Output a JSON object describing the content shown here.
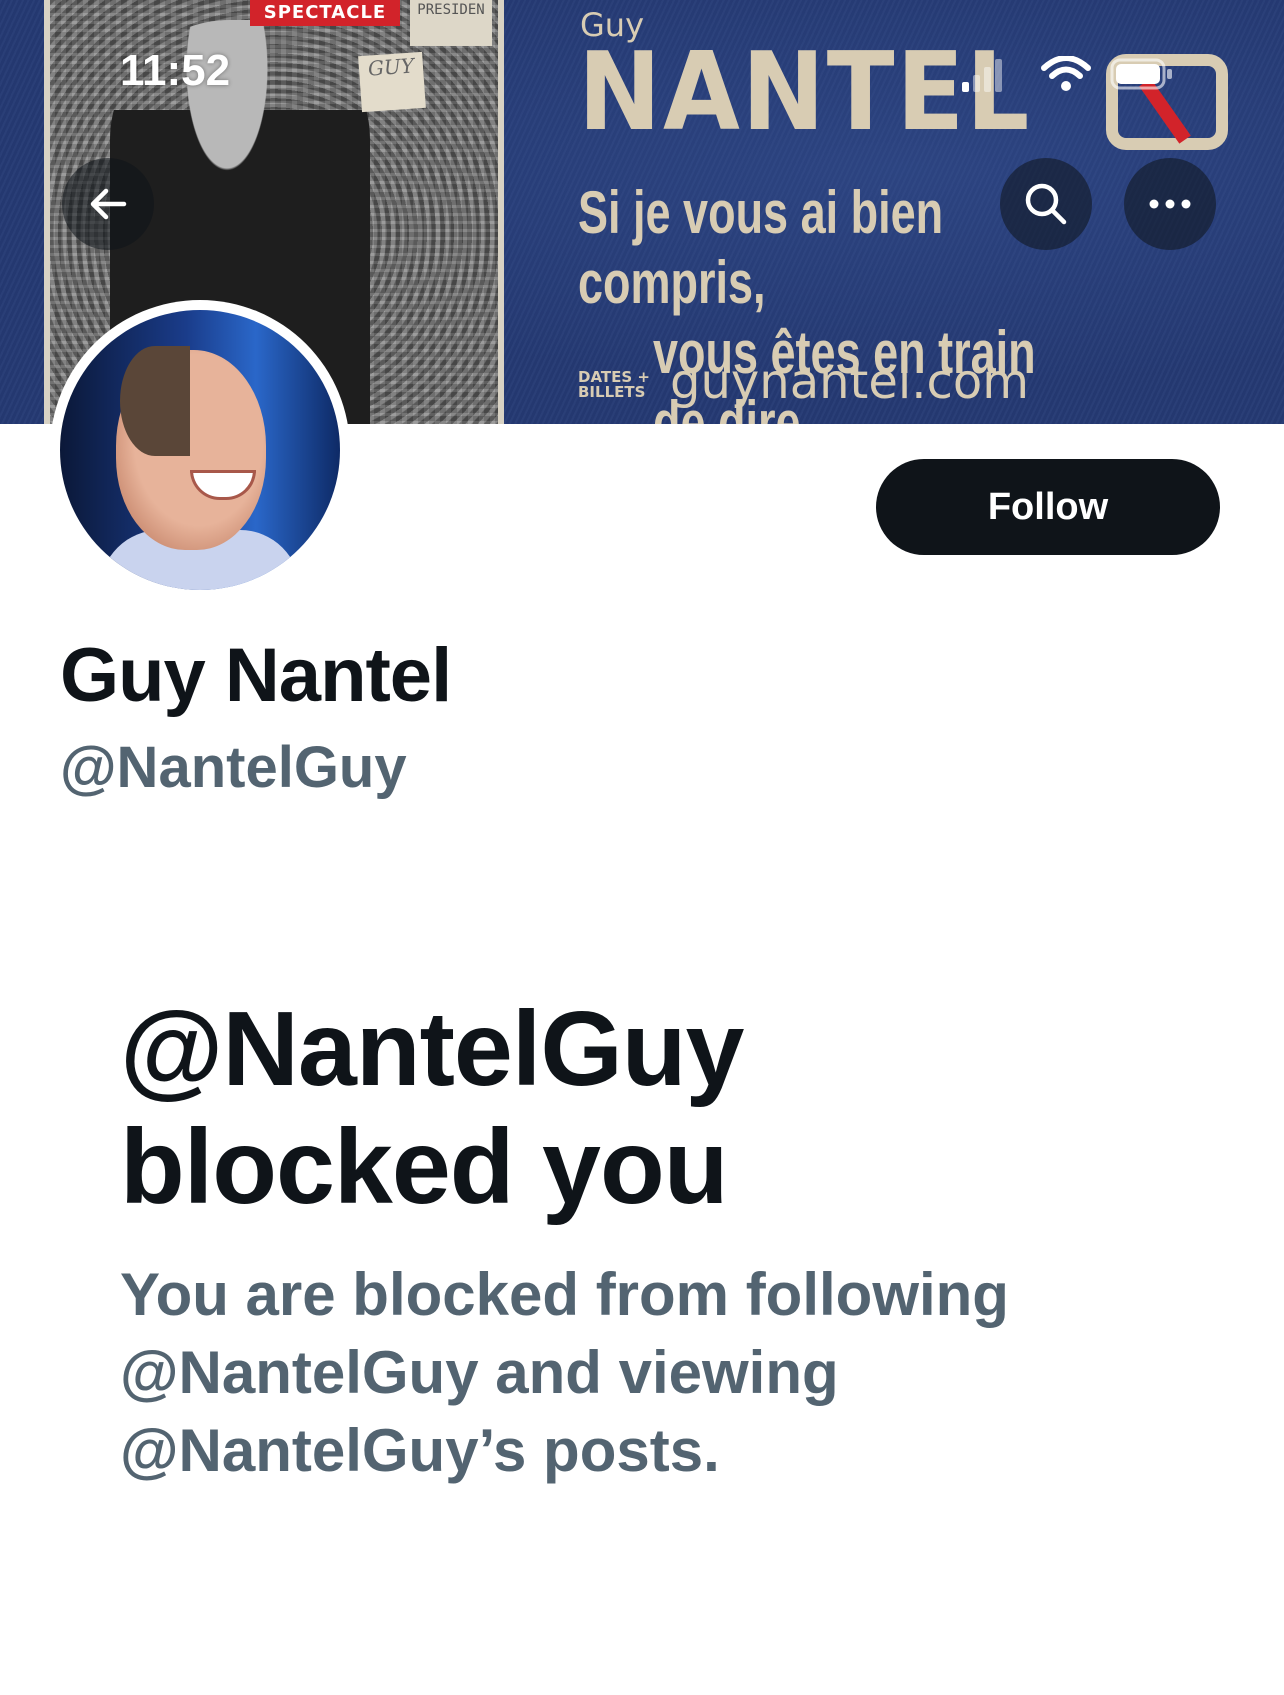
{
  "status_bar": {
    "time": "11:52"
  },
  "banner": {
    "poster_tag": "SPECTACLE",
    "poster_sign_top": "PRESIDEN",
    "poster_sign_small": "GUY",
    "brand_first": "Guy",
    "brand_last": "NANTEL",
    "tagline_line1": "Si je vous ai bien compris,",
    "tagline_line2": "vous êtes en train de dire...",
    "dates_line1": "DATES +",
    "dates_line2": "BILLETS",
    "url": "guynantel.com"
  },
  "nav": {
    "back_icon": "arrow-left-icon",
    "search_icon": "search-icon",
    "more_icon": "more-horizontal-icon"
  },
  "profile": {
    "follow_label": "Follow",
    "display_name": "Guy Nantel",
    "handle": "@NantelGuy"
  },
  "blocked": {
    "title_line1": "@NantelGuy",
    "title_line2": "blocked you",
    "description": "You are blocked from following @NantelGuy and viewing @NantelGuy’s posts."
  },
  "colors": {
    "primary_text": "#0f1419",
    "secondary_text": "#536471",
    "follow_button_bg": "#0f1419",
    "banner_blue": "#253a74"
  }
}
